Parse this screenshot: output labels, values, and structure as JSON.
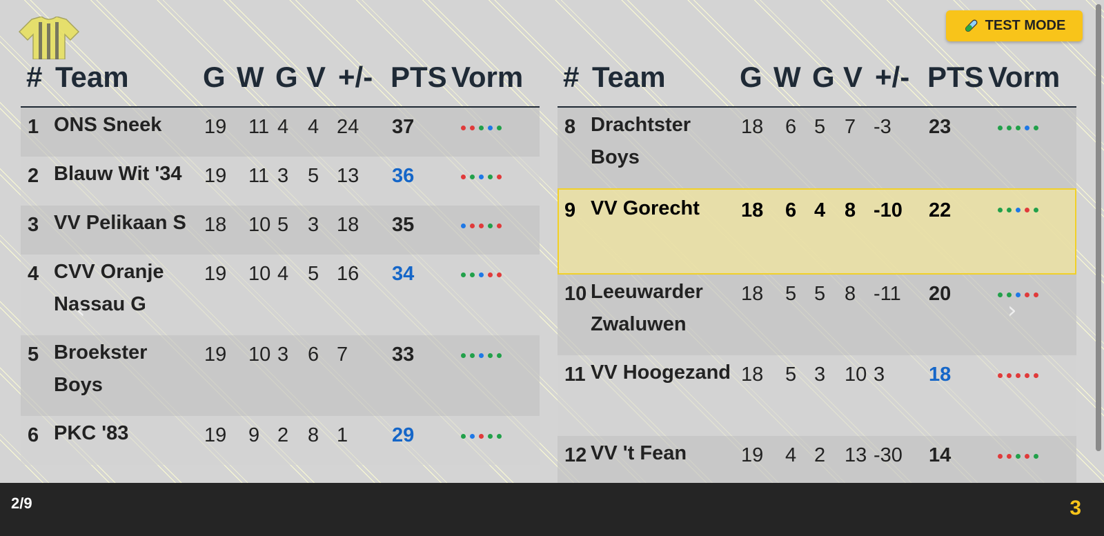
{
  "test_mode_label": "TEST MODE",
  "colors": {
    "win": "#22a04a",
    "loss": "#e03a3a",
    "draw": "#1e78e6",
    "accent": "#f8c41a",
    "highlight": "#f1d028",
    "up": "#1566c8"
  },
  "headers": {
    "rank": "#",
    "team": "Team",
    "played": "G",
    "won": "W",
    "drawn": "G",
    "lost": "V",
    "diff": "+/-",
    "points": "PTS",
    "form": "Vorm"
  },
  "left_table": {
    "rows": [
      {
        "rank": "1",
        "team": "ONS Sneek",
        "played": "19",
        "won": "11",
        "drawn": "4",
        "lost": "4",
        "diff": "24",
        "points": "37",
        "points_up": false,
        "form": [
          "L",
          "L",
          "W",
          "D",
          "W"
        ]
      },
      {
        "rank": "2",
        "team": "Blauw Wit '34",
        "played": "19",
        "won": "11",
        "drawn": "3",
        "lost": "5",
        "diff": "13",
        "points": "36",
        "points_up": true,
        "form": [
          "L",
          "W",
          "D",
          "W",
          "L"
        ]
      },
      {
        "rank": "3",
        "team": "VV Pelikaan S",
        "played": "18",
        "won": "10",
        "drawn": "5",
        "lost": "3",
        "diff": "18",
        "points": "35",
        "points_up": false,
        "form": [
          "D",
          "L",
          "L",
          "W",
          "L"
        ]
      },
      {
        "rank": "4",
        "team": "CVV Oranje Nassau G",
        "played": "19",
        "won": "10",
        "drawn": "4",
        "lost": "5",
        "diff": "16",
        "points": "34",
        "points_up": true,
        "form": [
          "W",
          "W",
          "D",
          "L",
          "L"
        ]
      },
      {
        "rank": "5",
        "team": "Broekster Boys",
        "played": "19",
        "won": "10",
        "drawn": "3",
        "lost": "6",
        "diff": "7",
        "points": "33",
        "points_up": false,
        "form": [
          "W",
          "W",
          "D",
          "W",
          "W"
        ]
      },
      {
        "rank": "6",
        "team": "PKC '83",
        "played": "19",
        "won": "9",
        "drawn": "2",
        "lost": "8",
        "diff": "1",
        "points": "29",
        "points_up": true,
        "form": [
          "W",
          "D",
          "L",
          "W",
          "W"
        ]
      }
    ]
  },
  "right_table": {
    "rows": [
      {
        "rank": "8",
        "team": "Drachtster Boys",
        "played": "18",
        "won": "6",
        "drawn": "5",
        "lost": "7",
        "diff": "-3",
        "points": "23",
        "points_up": false,
        "form": [
          "W",
          "W",
          "W",
          "D",
          "W"
        ]
      },
      {
        "rank": "9",
        "team": "VV Gorecht",
        "played": "18",
        "won": "6",
        "drawn": "4",
        "lost": "8",
        "diff": "-10",
        "points": "22",
        "points_up": false,
        "highlight": true,
        "form": [
          "W",
          "W",
          "D",
          "L",
          "W"
        ]
      },
      {
        "rank": "10",
        "team": "Leeuwarder Zwaluwen",
        "played": "18",
        "won": "5",
        "drawn": "5",
        "lost": "8",
        "diff": "-11",
        "points": "20",
        "points_up": false,
        "form": [
          "W",
          "W",
          "D",
          "L",
          "L"
        ]
      },
      {
        "rank": "11",
        "team": "VV Hoogezand",
        "played": "18",
        "won": "5",
        "drawn": "3",
        "lost": "10",
        "diff": "3",
        "points": "18",
        "points_up": true,
        "form": [
          "L",
          "L",
          "L",
          "L",
          "L"
        ]
      },
      {
        "rank": "12",
        "team": "VV 't Fean",
        "played": "19",
        "won": "4",
        "drawn": "2",
        "lost": "13",
        "diff": "-30",
        "points": "14",
        "points_up": false,
        "form": [
          "L",
          "L",
          "W",
          "L",
          "W"
        ]
      }
    ]
  },
  "footer": {
    "page_indicator": "2/9",
    "countdown": "3"
  }
}
